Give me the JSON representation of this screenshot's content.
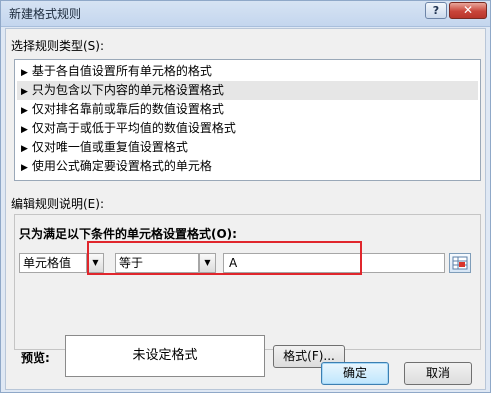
{
  "window": {
    "title": "新建格式规则",
    "help_label": "?",
    "close_label": "✕"
  },
  "select_rule_type_label": "选择规则类型(S):",
  "rule_types": [
    {
      "label": "基于各自值设置所有单元格的格式",
      "selected": false
    },
    {
      "label": "只为包含以下内容的单元格设置格式",
      "selected": true
    },
    {
      "label": "仅对排名靠前或靠后的数值设置格式",
      "selected": false
    },
    {
      "label": "仅对高于或低于平均值的数值设置格式",
      "selected": false
    },
    {
      "label": "仅对唯一值或重复值设置格式",
      "selected": false
    },
    {
      "label": "使用公式确定要设置格式的单元格",
      "selected": false
    }
  ],
  "edit_rule_label": "编辑规则说明(E):",
  "condition_heading": "只为满足以下条件的单元格设置格式(O):",
  "condition": {
    "cell_type": "单元格值",
    "operator": "等于",
    "value": "A"
  },
  "preview": {
    "label": "预览:",
    "text": "未设定格式",
    "format_button": "格式(F)..."
  },
  "buttons": {
    "ok": "确定",
    "cancel": "取消"
  },
  "highlight_color": "#e0262c"
}
